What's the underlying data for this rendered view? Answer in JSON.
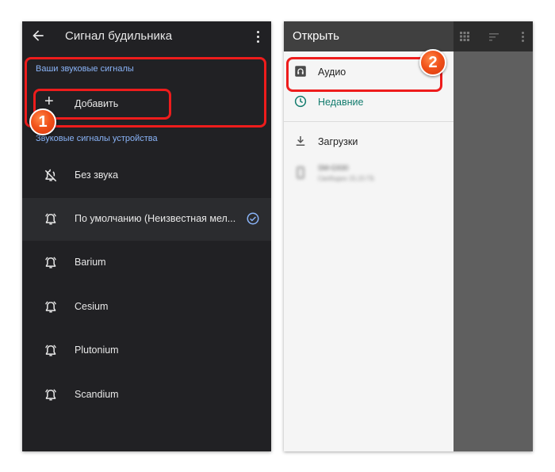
{
  "left_screen": {
    "title": "Сигнал будильника",
    "icons": {
      "back": "arrow-back-icon",
      "menu": "more-vert-icon"
    },
    "your_sounds_label": "Ваши звуковые сигналы",
    "add_label": "Добавить",
    "device_sounds_label": "Звуковые сигналы устройства",
    "items": [
      {
        "label": "Без звука",
        "icon": "bell-off-icon"
      },
      {
        "label": "По умолчанию (Неизвестная мел...",
        "icon": "alarm-bell-icon",
        "selected": true
      },
      {
        "label": "Barium",
        "icon": "alarm-bell-icon"
      },
      {
        "label": "Cesium",
        "icon": "alarm-bell-icon"
      },
      {
        "label": "Plutonium",
        "icon": "alarm-bell-icon"
      },
      {
        "label": "Scandium",
        "icon": "alarm-bell-icon"
      }
    ]
  },
  "right_screen": {
    "title": "Открыть",
    "items": [
      {
        "label": "Аудио",
        "icon": "audio-file-icon"
      },
      {
        "label": "Недавние",
        "icon": "clock-icon"
      },
      {
        "label": "Загрузки",
        "icon": "download-icon"
      }
    ],
    "device": {
      "name": "SM-G930",
      "free": "Свободно 15,15 ГБ"
    }
  },
  "annotations": {
    "badge1": "1",
    "badge2": "2"
  },
  "colors": {
    "left_bg": "#212124",
    "accent_blue": "#8ab4f8",
    "recent_teal": "#137c6e",
    "callout_red": "#ee1c1c",
    "badge_orange": "#f1521a"
  }
}
